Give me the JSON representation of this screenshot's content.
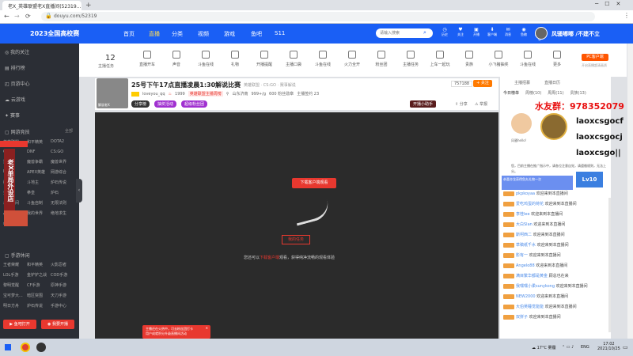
{
  "browser": {
    "tab_title": "老X_英雄联盟老X直播间(52319...",
    "url": "douyu.com/52319"
  },
  "header": {
    "logo": "2023全国高校赛",
    "nav": [
      "首页",
      "直播",
      "分类",
      "视频",
      "游戏",
      "鱼吧",
      "S11"
    ],
    "search_placeholder": "请输入搜索",
    "right_icons": [
      "历史",
      "关注",
      "开播",
      "客户端",
      "消息",
      "鱼粮",
      "稳帽中心"
    ],
    "username": "风骚嘟嘟 /不建不立"
  },
  "sidebar": {
    "items": [
      "我的关注",
      "排行榜",
      "页游中心",
      "云游戏",
      "赛事"
    ],
    "section_network": "网游竞技",
    "section_network_more": "全部",
    "network_games": [
      "英雄联盟",
      "和平精英",
      "DOTA2",
      "CFHD",
      "DNF",
      "CS:GO",
      "逆战",
      "魔兽争霸",
      "魔兽世界",
      "DOTA",
      "APEX英雄",
      "网游综合",
      "街机",
      "斗地主",
      "炉石传说",
      "金铲铲",
      "拳皇",
      "炉石",
      "永劫无间",
      "斗鱼自制",
      "无限法则",
      "战争雷霆",
      "我的世界",
      "绝地求生",
      "命运方舟"
    ],
    "section_mobile": "手游休闲",
    "mobile_games": [
      "王者荣耀",
      "和平精英",
      "火影忍者",
      "LOL手游",
      "金铲铲之战",
      "COD手游",
      "黎明觉醒",
      "CF手游",
      "原神手游",
      "宝可梦大...",
      "暗区突围",
      "天刀手游",
      "明日方舟",
      "炉石传说",
      "手游中心"
    ],
    "btn_left": "鱼吧打开",
    "btn_right": "我要开播",
    "promo_vertical": "老X单局外设店"
  },
  "toolbar": {
    "fans": "12",
    "fans_label": "主播任务",
    "tools": [
      "直播开车",
      "声音",
      "斗鱼在线",
      "礼物",
      "开播提醒",
      "主播口袋",
      "斗鱼在线",
      "火力全开",
      "粉丝团",
      "主播任务",
      "上车一起玩",
      "贵族",
      "小飞猪抽奖",
      "斗鱼在线",
      "更多"
    ],
    "pc_btn": "PC客户端",
    "pc_hint": "开启直播超清画质"
  },
  "room": {
    "title": "25号下午17点直播凌晨1:30解说比赛",
    "category": "英雄联盟 · CS:GO · 赛事解说",
    "streamer": "loveyou_qq",
    "heat": "1999",
    "rank_text": "英雄联盟主播周榜",
    "location": "山东济南",
    "fans_count": "999+/g",
    "subs": "600 粉丝勋章",
    "extra": "主播签约 23",
    "follow_count": "757188",
    "follow_btn": "关注",
    "tags": [
      "分享榜",
      "抽奖活动",
      "超级粉丝团"
    ],
    "share": "分享",
    "report": "举报",
    "sticker_btn": "开播小助手"
  },
  "player": {
    "download_btn": "下载客户端观看",
    "center_btn": "我的任务",
    "hint_prefix": "您还可以",
    "hint_link": "下载客户端",
    "hint_suffix": "观看，获得纯净流畅的观看体验",
    "toast_line1": "主播还在火热中，可去粉丝团打卡",
    "toast_line2": "用户成就积分升级直播间活动"
  },
  "right": {
    "tabs": [
      "主播招募",
      "直播日历"
    ],
    "subtabs": [
      "今日榜单",
      "周榜(10)",
      "周周(11)",
      "贵族(13)"
    ],
    "overlay_text1": "水友群：978352079",
    "overlay_text2": "laoxcsgocf",
    "overlay_text3": "laoxcsgocj",
    "overlay_text4": "laoxcsgo||",
    "avatar_name": "风骚hello!",
    "notice": "您，目前主播在推广指示中，请各位注意自觉，请遵循规则，无法上分。",
    "chat_header": "恭喜亦龙获得鱼丸礼物一次",
    "chats": [
      {
        "user": "pkpkoyaa",
        "msg": "欢迎来到本直播间"
      },
      {
        "user": "爱吃鸡蛋的荷花",
        "msg": "欢迎来到本直播间"
      },
      {
        "user": "李桂lee",
        "msg": "欢迎来到本直播间"
      },
      {
        "user": "大白Slan",
        "msg": "欢迎来到本直播间"
      },
      {
        "user": "斯柯西二",
        "msg": "欢迎来到本直播间"
      },
      {
        "user": "草稿纸千水",
        "msg": "欢迎来到本直播间"
      },
      {
        "user": "影有一",
        "msg": "欢迎来到本直播间"
      },
      {
        "user": "Angelo88",
        "msg": "欢迎来到本直播间"
      },
      {
        "user": "满目繁华都是黄金",
        "msg": "顾总也在来"
      },
      {
        "user": "我嘿嘿小柔sunykong",
        "msg": "欢迎来到本直播间"
      },
      {
        "user": "NEW2000",
        "msg": "欢迎来到本直播间"
      },
      {
        "user": "大伯吴睡觉能能",
        "msg": "欢迎来到本直播间"
      },
      {
        "user": "双拼子",
        "msg": "欢迎来到本直播间"
      }
    ]
  },
  "taskbar": {
    "weather": "17°C 雾霾",
    "lang": "ENG",
    "time": "17:02",
    "date": "2021/10/25"
  },
  "colors": {
    "accent": "#1a5ff5",
    "sidebar": "#2b2e35",
    "brand_red": "#e8382f",
    "orange": "#ff7a00"
  }
}
